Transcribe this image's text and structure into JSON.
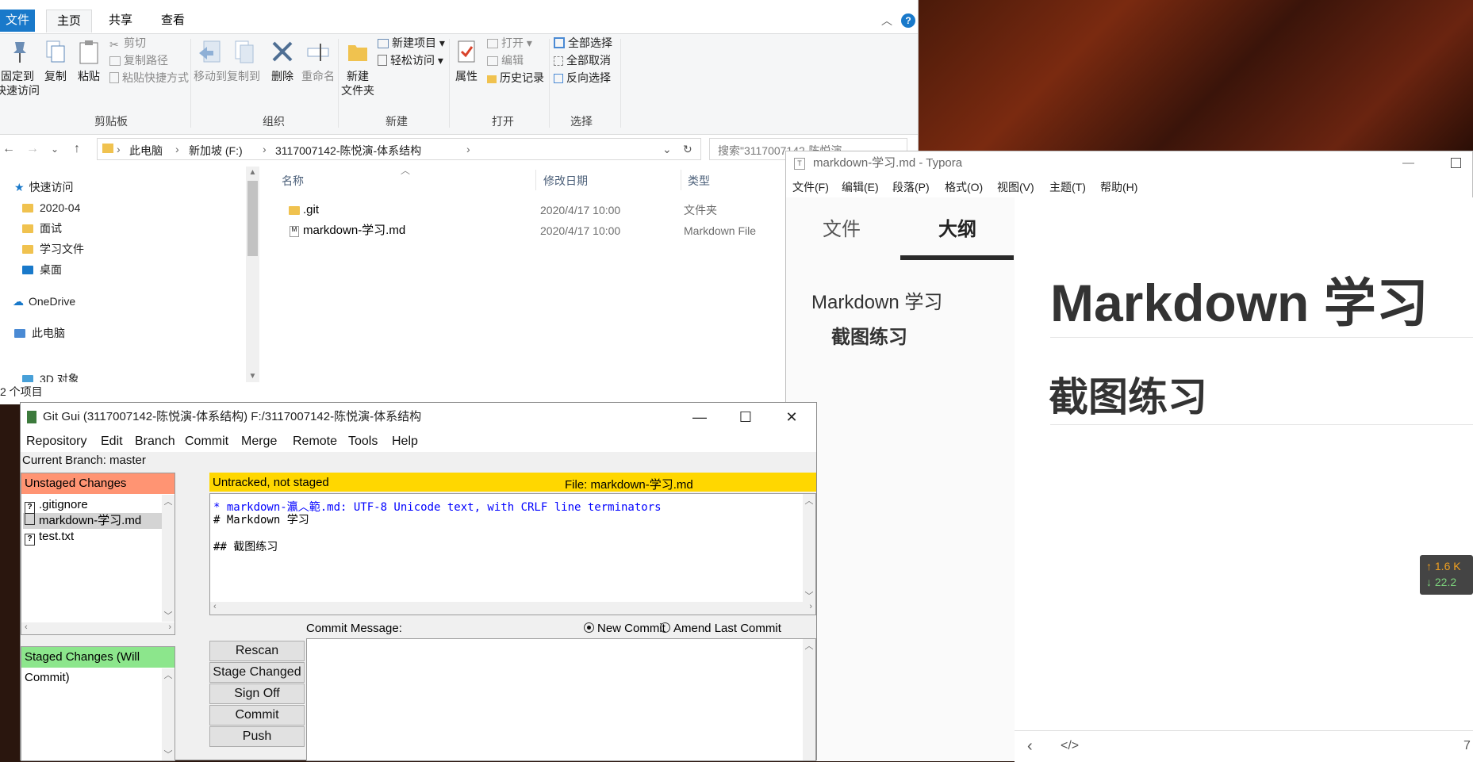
{
  "explorer": {
    "tabs": {
      "file": "文件",
      "home": "主页",
      "share": "共享",
      "view": "查看"
    },
    "ribbon": {
      "pin": "固定到\n快速访问",
      "copy": "复制",
      "paste": "粘贴",
      "cut": "剪切",
      "copy_path": "复制路径",
      "paste_shortcut": "粘贴快捷方式",
      "move_to": "移动到",
      "copy_to": "复制到",
      "delete": "删除",
      "rename": "重命名",
      "new_folder": "新建\n文件夹",
      "new_item": "新建项目 ▾",
      "easy_access": "轻松访问 ▾",
      "properties": "属性",
      "open": "打开 ▾",
      "edit": "编辑",
      "history": "历史记录",
      "select_all": "全部选择",
      "select_none": "全部取消",
      "invert": "反向选择",
      "groups": {
        "clipboard": "剪贴板",
        "organize": "组织",
        "new": "新建",
        "open": "打开",
        "select": "选择"
      }
    },
    "breadcrumb": [
      "此电脑",
      "新加坡 (F:)",
      "3117007142-陈悦演-体系结构"
    ],
    "search_placeholder": "搜索\"3117007142-陈悦演...",
    "nav": {
      "quick_access": "快速访问",
      "items": [
        "2020-04",
        "面试",
        "学习文件",
        "桌面"
      ],
      "onedrive": "OneDrive",
      "this_pc": "此电脑",
      "objects3d": "3D 对象"
    },
    "columns": {
      "name": "名称",
      "modified": "修改日期",
      "type": "类型"
    },
    "files": [
      {
        "name": ".git",
        "date": "2020/4/17 10:00",
        "type": "文件夹"
      },
      {
        "name": "markdown-学习.md",
        "date": "2020/4/17 10:00",
        "type": "Markdown File"
      }
    ],
    "status": "2 个项目"
  },
  "typora": {
    "title": "markdown-学习.md - Typora",
    "menu": [
      "文件(F)",
      "编辑(E)",
      "段落(P)",
      "格式(O)",
      "视图(V)",
      "主题(T)",
      "帮助(H)"
    ],
    "side_tabs": {
      "files": "文件",
      "outline": "大纲"
    },
    "outline": {
      "h1": "Markdown 学习",
      "h2": "截图练习"
    },
    "doc": {
      "h1": "Markdown 学习",
      "h2": "截图练习"
    },
    "page_num": "7"
  },
  "netmon": {
    "up": "↑ 1.6 K",
    "down": "↓ 22.2"
  },
  "gitgui": {
    "title": "Git Gui (3117007142-陈悦演-体系结构) F:/3117007142-陈悦演-体系结构",
    "menu": [
      "Repository",
      "Edit",
      "Branch",
      "Commit",
      "Merge",
      "Remote",
      "Tools",
      "Help"
    ],
    "branch": "Current Branch: master",
    "unstaged_header": "Unstaged Changes",
    "unstaged_files": [
      ".gitignore",
      "markdown-学习.md",
      "test.txt"
    ],
    "staged_header": "Staged Changes (Will Commit)",
    "diff_status": "Untracked, not staged",
    "diff_file": "File:  markdown-学习.md",
    "diff_lines": [
      "* markdown-瀛︿範.md: UTF-8 Unicode text, with CRLF line terminators",
      "# Markdown 学习",
      "",
      "## 截图练习"
    ],
    "commit_message_label": "Commit Message:",
    "new_commit": "New Commit",
    "amend": "Amend Last Commit",
    "buttons": [
      "Rescan",
      "Stage Changed",
      "Sign Off",
      "Commit",
      "Push"
    ]
  },
  "colors": {
    "accent": "#1979ca",
    "unstaged": "#ff9473",
    "staged": "#8ce68c",
    "diff_header": "#ffd700",
    "diff_meta": "#0000ff"
  }
}
